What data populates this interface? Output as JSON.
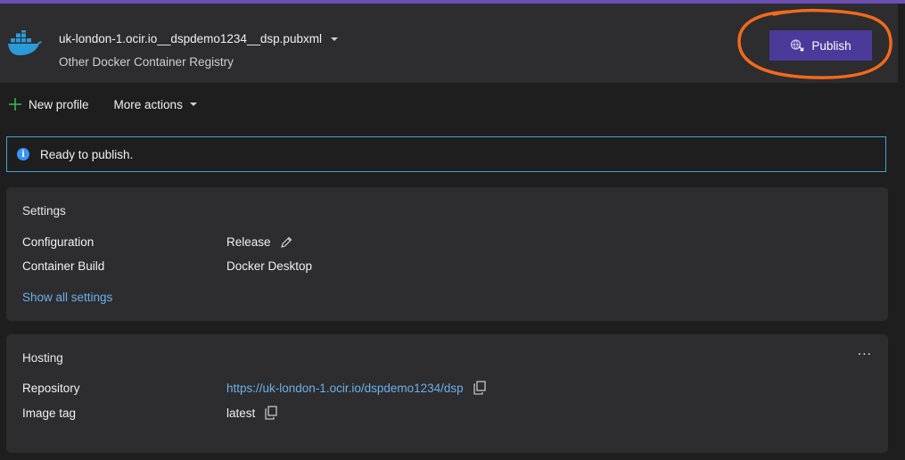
{
  "header": {
    "profile_name": "uk-london-1.ocir.io__dspdemo1234__dsp.pubxml",
    "profile_subtitle": "Other Docker Container Registry",
    "publish_label": "Publish",
    "icons": {
      "logo": "docker-whale-icon",
      "publish": "globe-publish-icon",
      "dropdown": "chevron-down-icon"
    }
  },
  "toolbar": {
    "new_profile": "New profile",
    "more_actions": "More actions"
  },
  "info": {
    "message": "Ready to publish."
  },
  "settings": {
    "title": "Settings",
    "rows": [
      {
        "label": "Configuration",
        "value": "Release"
      },
      {
        "label": "Container Build",
        "value": "Docker Desktop"
      }
    ],
    "show_all": "Show all settings"
  },
  "hosting": {
    "title": "Hosting",
    "more": "...",
    "rows": [
      {
        "label": "Repository",
        "value": "https://uk-london-1.ocir.io/dspdemo1234/dsp"
      },
      {
        "label": "Image tag",
        "value": "latest"
      }
    ]
  },
  "colors": {
    "accent": "#6c4fb5",
    "publish_button": "#4b3a9a",
    "info_border": "#3ea5d6",
    "link": "#6cb0e6",
    "annotation": "#f26a1b",
    "add_icon": "#3fb950"
  }
}
